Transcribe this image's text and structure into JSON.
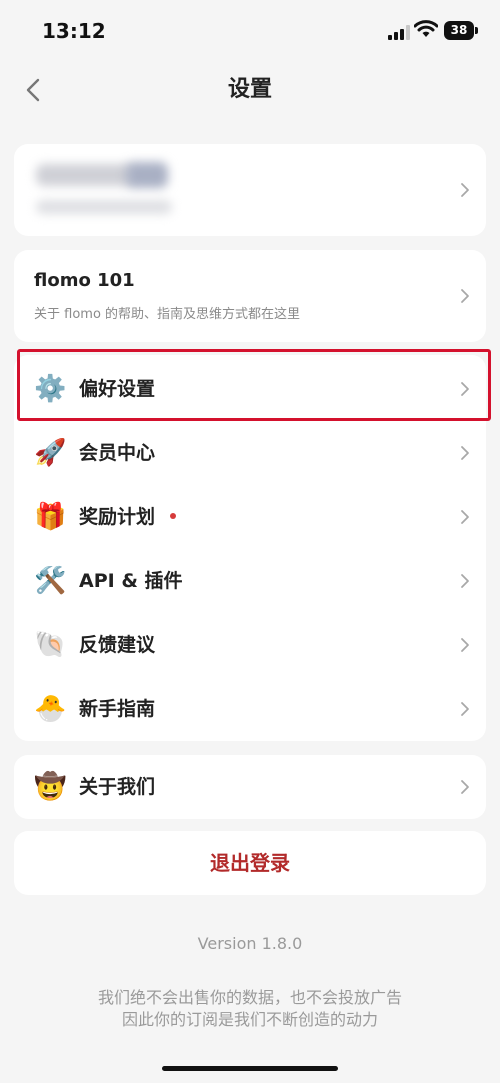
{
  "status_bar": {
    "time": "13:12",
    "battery": "38"
  },
  "nav": {
    "title": "设置",
    "back_icon": "chevron-left-icon"
  },
  "profile_card": {
    "chevron_icon": "chevron-right-icon"
  },
  "flomo_card": {
    "title": "flomo 101",
    "subtitle": "关于 flomo 的帮助、指南及思维方式都在这里"
  },
  "menu": {
    "items": [
      {
        "icon": "gear-icon",
        "emoji": "⚙️",
        "label": "偏好设置"
      },
      {
        "icon": "rocket-icon",
        "emoji": "🚀",
        "label": "会员中心"
      },
      {
        "icon": "gift-icon",
        "emoji": "🎁",
        "label": "奖励计划",
        "badge": "red-dot"
      },
      {
        "icon": "tools-icon",
        "emoji": "🛠️",
        "label": "API & 插件"
      },
      {
        "icon": "shell-icon",
        "emoji": "🐚",
        "label": "反馈建议"
      },
      {
        "icon": "hatching-chick-icon",
        "emoji": "🐣",
        "label": "新手指南"
      }
    ]
  },
  "about": {
    "icon": "cowboy-face-icon",
    "emoji": "🤠",
    "label": "关于我们"
  },
  "logout": {
    "label": "退出登录"
  },
  "footer": {
    "version": "Version 1.8.0",
    "line1": "我们绝不会出售你的数据，也不会投放广告",
    "line2": "因此你的订阅是我们不断创造的动力"
  },
  "colors": {
    "accent_red": "#b22a2a",
    "highlight_red": "#d4112d",
    "background": "#f5f5f5"
  }
}
